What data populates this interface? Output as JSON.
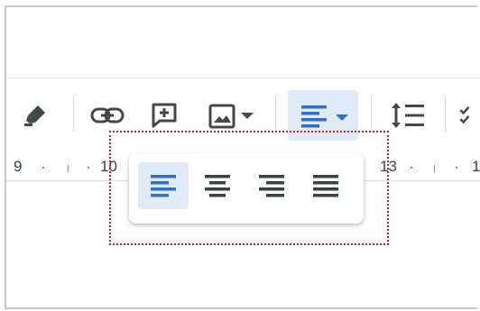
{
  "toolbar": {
    "items": [
      {
        "name": "highlight-color-button",
        "icon": "marker-icon"
      },
      {
        "name": "insert-link-button",
        "icon": "link-icon"
      },
      {
        "name": "add-comment-button",
        "icon": "comment-plus-icon"
      },
      {
        "name": "insert-image-button",
        "icon": "image-icon"
      },
      {
        "name": "align-menu-button",
        "icon": "align-left-icon",
        "active": true
      },
      {
        "name": "line-spacing-button",
        "icon": "line-spacing-icon"
      },
      {
        "name": "checklist-button",
        "icon": "checklist-icon"
      }
    ],
    "accent_color": "#2f6ed2",
    "active_bg": "#e1ebf7"
  },
  "ruler": {
    "labels": [
      "9",
      "10",
      "13",
      "1"
    ]
  },
  "align_menu": {
    "options": [
      {
        "name": "align-left-option",
        "icon": "align-left-icon",
        "selected": true
      },
      {
        "name": "align-center-option",
        "icon": "align-center-icon",
        "selected": false
      },
      {
        "name": "align-right-option",
        "icon": "align-right-icon",
        "selected": false
      },
      {
        "name": "align-justify-option",
        "icon": "align-justify-icon",
        "selected": false
      }
    ]
  },
  "annotation": {
    "style": "dotted-box",
    "color": "#c8202a"
  }
}
